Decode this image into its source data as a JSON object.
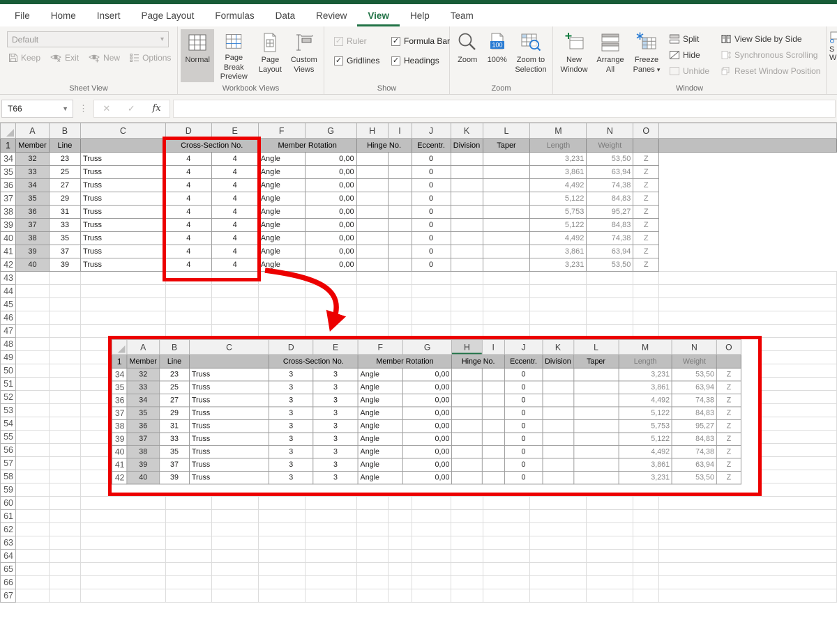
{
  "ribbon": {
    "tabs": [
      "File",
      "Home",
      "Insert",
      "Page Layout",
      "Formulas",
      "Data",
      "Review",
      "View",
      "Help",
      "Team"
    ],
    "active_tab": "View",
    "sheet_view": {
      "label": "Sheet View",
      "combo": "Default",
      "keep": "Keep",
      "exit": "Exit",
      "new": "New",
      "options": "Options"
    },
    "workbook_views": {
      "label": "Workbook Views",
      "normal": "Normal",
      "page_break": "Page Break Preview",
      "page_layout": "Page Layout",
      "custom_views": "Custom Views"
    },
    "show": {
      "label": "Show",
      "ruler": "Ruler",
      "gridlines": "Gridlines",
      "formula_bar": "Formula Bar",
      "headings": "Headings"
    },
    "zoom": {
      "label": "Zoom",
      "zoom": "Zoom",
      "pct": "100%",
      "zoom_sel": "Zoom to Selection",
      "badge": "100"
    },
    "window": {
      "label": "Window",
      "new_window": "New Window",
      "arrange": "Arrange All",
      "freeze": "Freeze Panes",
      "split": "Split",
      "hide": "Hide",
      "unhide": "Unhide",
      "side": "View Side by Side",
      "sync": "Synchronous Scrolling",
      "reset": "Reset Window Position",
      "switch_partial_1": "S",
      "switch_partial_2": "Wi"
    }
  },
  "formula_bar": {
    "name_box": "T66",
    "cancel": "✕",
    "enter": "✓",
    "fx": "fx",
    "value": ""
  },
  "sheet": {
    "col_letters": [
      "A",
      "B",
      "C",
      "D",
      "E",
      "F",
      "G",
      "H",
      "I",
      "J",
      "K",
      "L",
      "M",
      "N",
      "O"
    ],
    "header_labels": {
      "member": "Member",
      "line": "Line",
      "cross_section": "Cross-Section No.",
      "member_rotation": "Member Rotation",
      "hinge": "Hinge No.",
      "eccentr": "Eccentr.",
      "division": "Division",
      "taper": "Taper",
      "length": "Length",
      "weight": "Weight"
    },
    "rows": [
      {
        "n": "34",
        "member": "32",
        "line": "23",
        "type": "Truss",
        "rot_type": "Angle",
        "rot": "0,00",
        "ecc": "0",
        "len": "3,231",
        "wt": "53,50",
        "ax": "Z"
      },
      {
        "n": "35",
        "member": "33",
        "line": "25",
        "type": "Truss",
        "rot_type": "Angle",
        "rot": "0,00",
        "ecc": "0",
        "len": "3,861",
        "wt": "63,94",
        "ax": "Z"
      },
      {
        "n": "36",
        "member": "34",
        "line": "27",
        "type": "Truss",
        "rot_type": "Angle",
        "rot": "0,00",
        "ecc": "0",
        "len": "4,492",
        "wt": "74,38",
        "ax": "Z"
      },
      {
        "n": "37",
        "member": "35",
        "line": "29",
        "type": "Truss",
        "rot_type": "Angle",
        "rot": "0,00",
        "ecc": "0",
        "len": "5,122",
        "wt": "84,83",
        "ax": "Z"
      },
      {
        "n": "38",
        "member": "36",
        "line": "31",
        "type": "Truss",
        "rot_type": "Angle",
        "rot": "0,00",
        "ecc": "0",
        "len": "5,753",
        "wt": "95,27",
        "ax": "Z"
      },
      {
        "n": "39",
        "member": "37",
        "line": "33",
        "type": "Truss",
        "rot_type": "Angle",
        "rot": "0,00",
        "ecc": "0",
        "len": "5,122",
        "wt": "84,83",
        "ax": "Z"
      },
      {
        "n": "40",
        "member": "38",
        "line": "35",
        "type": "Truss",
        "rot_type": "Angle",
        "rot": "0,00",
        "ecc": "0",
        "len": "4,492",
        "wt": "74,38",
        "ax": "Z"
      },
      {
        "n": "41",
        "member": "39",
        "line": "37",
        "type": "Truss",
        "rot_type": "Angle",
        "rot": "0,00",
        "ecc": "0",
        "len": "3,861",
        "wt": "63,94",
        "ax": "Z"
      },
      {
        "n": "42",
        "member": "40",
        "line": "39",
        "type": "Truss",
        "rot_type": "Angle",
        "rot": "0,00",
        "ecc": "0",
        "len": "3,231",
        "wt": "53,50",
        "ax": "Z"
      }
    ],
    "main_cross_section": "4",
    "inset_cross_section": "3",
    "inset_selected_col": "H",
    "empty_row_start": 43,
    "empty_row_end": 67
  },
  "annotations": {
    "highlight_color": "#EC0000"
  }
}
